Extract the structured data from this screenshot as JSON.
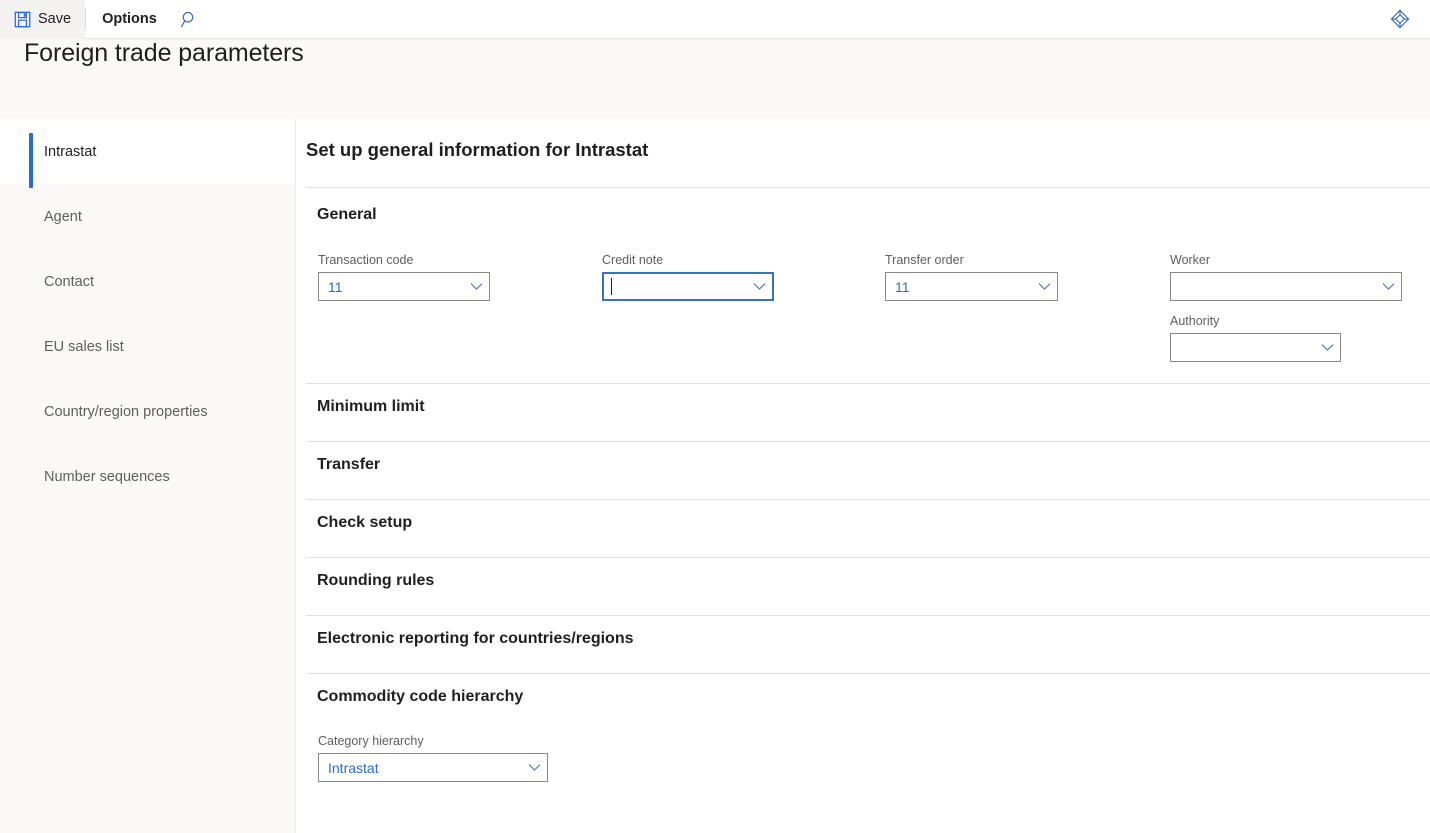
{
  "toolbar": {
    "save_label": "Save",
    "save_icon": "save-floppy-icon",
    "options_label": "Options",
    "search_icon": "search-icon",
    "right_icon": "diamond-rhombus-icon"
  },
  "header": {
    "title": "Foreign trade parameters"
  },
  "sidebar": {
    "items": [
      {
        "label": "Intrastat",
        "selected": true
      },
      {
        "label": "Agent",
        "selected": false
      },
      {
        "label": "Contact",
        "selected": false
      },
      {
        "label": "EU sales list",
        "selected": false
      },
      {
        "label": "Country/region properties",
        "selected": false
      },
      {
        "label": "Number sequences",
        "selected": false
      }
    ]
  },
  "main": {
    "title": "Set up general information for Intrastat",
    "sections": [
      {
        "label": "General",
        "expanded": true
      },
      {
        "label": "Minimum limit",
        "expanded": false
      },
      {
        "label": "Transfer",
        "expanded": false
      },
      {
        "label": "Check setup",
        "expanded": false
      },
      {
        "label": "Rounding rules",
        "expanded": false
      },
      {
        "label": "Electronic reporting for countries/regions",
        "expanded": false
      },
      {
        "label": "Commodity code hierarchy",
        "expanded": true
      }
    ],
    "general_fields": {
      "transaction_code": {
        "label": "Transaction code",
        "value": "11",
        "placeholder": "",
        "focused": false
      },
      "credit_note": {
        "label": "Credit note",
        "value": "",
        "placeholder": "",
        "focused": true
      },
      "transfer_order": {
        "label": "Transfer order",
        "value": "11",
        "placeholder": "",
        "focused": false
      },
      "worker": {
        "label": "Worker",
        "value": "",
        "placeholder": "",
        "focused": false
      },
      "authority": {
        "label": "Authority",
        "value": "",
        "placeholder": "",
        "focused": false
      }
    },
    "commodity_fields": {
      "category_hierarchy": {
        "label": "Category hierarchy",
        "value": "Intrastat",
        "placeholder": "",
        "focused": false
      }
    }
  },
  "colors": {
    "accent_blue": "#2a6ad4",
    "focus_blue": "#3b6fbf",
    "text_primary": "#201f1e",
    "text_secondary": "#605e5c",
    "bg_chrome": "#faf9f8",
    "border": "#8a8886"
  }
}
